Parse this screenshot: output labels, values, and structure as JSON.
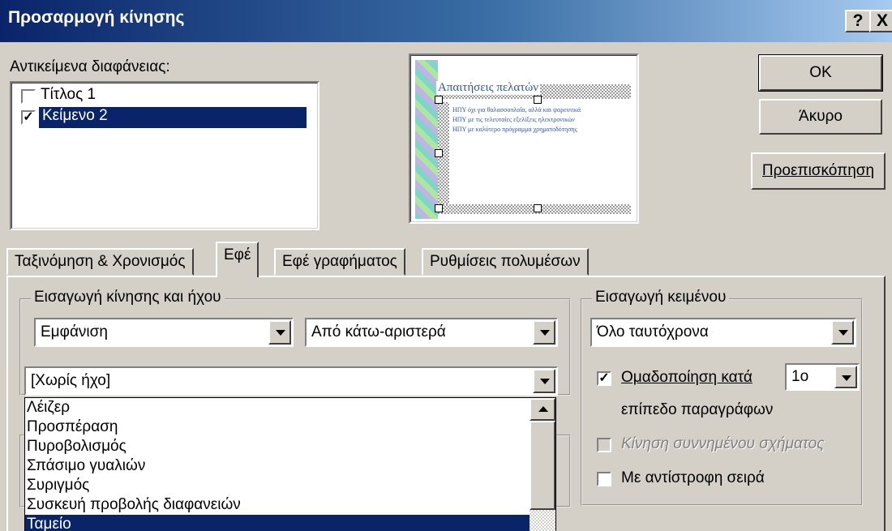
{
  "window": {
    "title": "Προσαρμογή κίνησης",
    "help_label": "?",
    "close_label": "X"
  },
  "objects": {
    "label": "Αντικείμενα διαφάνειας:",
    "items": [
      {
        "label": "Τίτλος 1",
        "checked": false
      },
      {
        "label": "Κείμενο 2",
        "checked": true,
        "selected": true
      }
    ]
  },
  "preview": {
    "slide_title": "Απαιτήσεις πελατών",
    "bullets": [
      "ΗΠΥ όχι για θαλασσοπλοΐα, αλλά και ψαρευτικά",
      "ΗΠΥ με τις τελευταίες εξελίξεις ηλεκτρονικών",
      "ΗΠΥ με καλύτερο πρόγραμμα χρηματοδότησης"
    ]
  },
  "buttons": {
    "ok": "OK",
    "cancel": "Άκυρο",
    "preview": "Προεπισκόπηση"
  },
  "tabs": [
    {
      "label": "Ταξινόμηση & Χρονισμός",
      "active": false
    },
    {
      "label": "Εφέ",
      "active": true
    },
    {
      "label": "Εφέ γραφήματος",
      "active": false
    },
    {
      "label": "Ρυθμίσεις πολυμέσων",
      "active": false
    }
  ],
  "entry": {
    "group_title": "Εισαγωγή κίνησης και ήχου",
    "effect_value": "Εμφάνιση",
    "direction_value": "Από κάτω-αριστερά",
    "sound_value": "[Χωρίς ήχο]",
    "sound_options": [
      "Λέιζερ",
      "Προσπέραση",
      "Πυροβολισμός",
      "Σπάσιμο γυαλιών",
      "Συριγμός",
      "Συσκευή προβολής διαφανειών",
      "Ταμείο"
    ],
    "selected_option": "Ταμείο"
  },
  "text_intro": {
    "group_title": "Εισαγωγή κειμένου",
    "mode_value": "Όλο ταυτόχρονα",
    "group_by_label": "Ομαδοποίηση κατά",
    "group_by_checked": true,
    "level_value": "1ο",
    "level_suffix": "επίπεδο παραγράφων",
    "attached_shape_label": "Κίνηση συννημένου σχήματος",
    "attached_shape_checked": false,
    "reverse_label": "Με αντίστροφη σειρά",
    "reverse_checked": false
  }
}
